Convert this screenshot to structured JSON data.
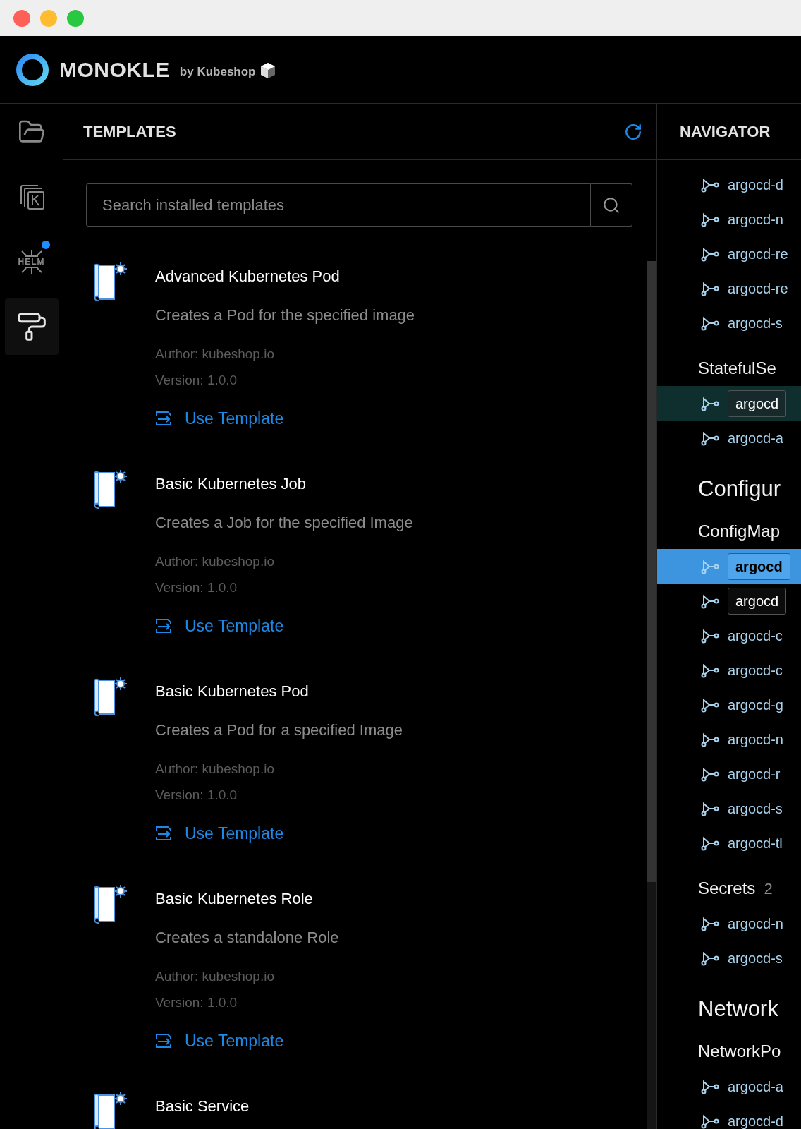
{
  "window": {
    "controls": [
      {
        "kind": "close"
      },
      {
        "kind": "minimize"
      },
      {
        "kind": "zoom"
      }
    ]
  },
  "header": {
    "brand": "MONOKLE",
    "byline": "by Kubeshop"
  },
  "rail": [
    {
      "kind": "folder",
      "selected": false,
      "badge": false
    },
    {
      "kind": "stack",
      "selected": false,
      "badge": false
    },
    {
      "kind": "helm",
      "label": "HELM",
      "selected": false,
      "badge": true
    },
    {
      "kind": "roller",
      "selected": true,
      "badge": false
    }
  ],
  "templates": {
    "title": "TEMPLATES",
    "search": {
      "placeholder": "Search installed templates"
    },
    "items": [
      {
        "title": "Advanced Kubernetes Pod",
        "description": "Creates a Pod for the specified image",
        "author": "Author: kubeshop.io",
        "version": "Version: 1.0.0",
        "action": "Use Template"
      },
      {
        "title": "Basic Kubernetes Job",
        "description": "Creates a Job for the specified Image",
        "author": "Author: kubeshop.io",
        "version": "Version: 1.0.0",
        "action": "Use Template"
      },
      {
        "title": "Basic Kubernetes Pod",
        "description": "Creates a Pod for a specified Image",
        "author": "Author: kubeshop.io",
        "version": "Version: 1.0.0",
        "action": "Use Template"
      },
      {
        "title": "Basic Kubernetes Role",
        "description": "Creates a standalone Role",
        "author": "Author: kubeshop.io",
        "version": "Version: 1.0.0",
        "action": "Use Template"
      },
      {
        "title": "Basic Service"
      }
    ]
  },
  "navigator": {
    "title": "NAVIGATOR",
    "items": [
      {
        "kind": "resource",
        "label": "argocd-d",
        "selected": false,
        "highlighted": false,
        "boxed": false
      },
      {
        "kind": "resource",
        "label": "argocd-n",
        "selected": false,
        "highlighted": false,
        "boxed": false
      },
      {
        "kind": "resource",
        "label": "argocd-re",
        "selected": false,
        "highlighted": false,
        "boxed": false
      },
      {
        "kind": "resource",
        "label": "argocd-re",
        "selected": false,
        "highlighted": false,
        "boxed": false
      },
      {
        "kind": "resource",
        "label": "argocd-s",
        "selected": false,
        "highlighted": false,
        "boxed": false
      },
      {
        "kind": "group",
        "label": "StatefulSe"
      },
      {
        "kind": "resource",
        "label": "argocd",
        "selected": false,
        "highlighted": true,
        "boxed": true
      },
      {
        "kind": "resource",
        "label": "argocd-a",
        "selected": false,
        "highlighted": false,
        "boxed": false
      },
      {
        "kind": "section",
        "label": "Configur"
      },
      {
        "kind": "group",
        "label": "ConfigMap"
      },
      {
        "kind": "resource",
        "label": "argocd",
        "selected": true,
        "highlighted": false,
        "boxed": true
      },
      {
        "kind": "resource",
        "label": "argocd",
        "selected": false,
        "highlighted": false,
        "boxed": true
      },
      {
        "kind": "resource",
        "label": "argocd-c",
        "selected": false,
        "highlighted": false,
        "boxed": false
      },
      {
        "kind": "resource",
        "label": "argocd-c",
        "selected": false,
        "highlighted": false,
        "boxed": false
      },
      {
        "kind": "resource",
        "label": "argocd-g",
        "selected": false,
        "highlighted": false,
        "boxed": false
      },
      {
        "kind": "resource",
        "label": "argocd-n",
        "selected": false,
        "highlighted": false,
        "boxed": false
      },
      {
        "kind": "resource",
        "label": "argocd-r",
        "selected": false,
        "highlighted": false,
        "boxed": false
      },
      {
        "kind": "resource",
        "label": "argocd-s",
        "selected": false,
        "highlighted": false,
        "boxed": false
      },
      {
        "kind": "resource",
        "label": "argocd-tl",
        "selected": false,
        "highlighted": false,
        "boxed": false
      },
      {
        "kind": "group",
        "label": "Secrets",
        "count": "2"
      },
      {
        "kind": "resource",
        "label": "argocd-n",
        "selected": false,
        "highlighted": false,
        "boxed": false
      },
      {
        "kind": "resource",
        "label": "argocd-s",
        "selected": false,
        "highlighted": false,
        "boxed": false
      },
      {
        "kind": "section",
        "label": "Network"
      },
      {
        "kind": "group",
        "label": "NetworkPo"
      },
      {
        "kind": "resource",
        "label": "argocd-a",
        "selected": false,
        "highlighted": false,
        "boxed": false
      },
      {
        "kind": "resource",
        "label": "argocd-d",
        "selected": false,
        "highlighted": false,
        "boxed": false
      }
    ]
  }
}
